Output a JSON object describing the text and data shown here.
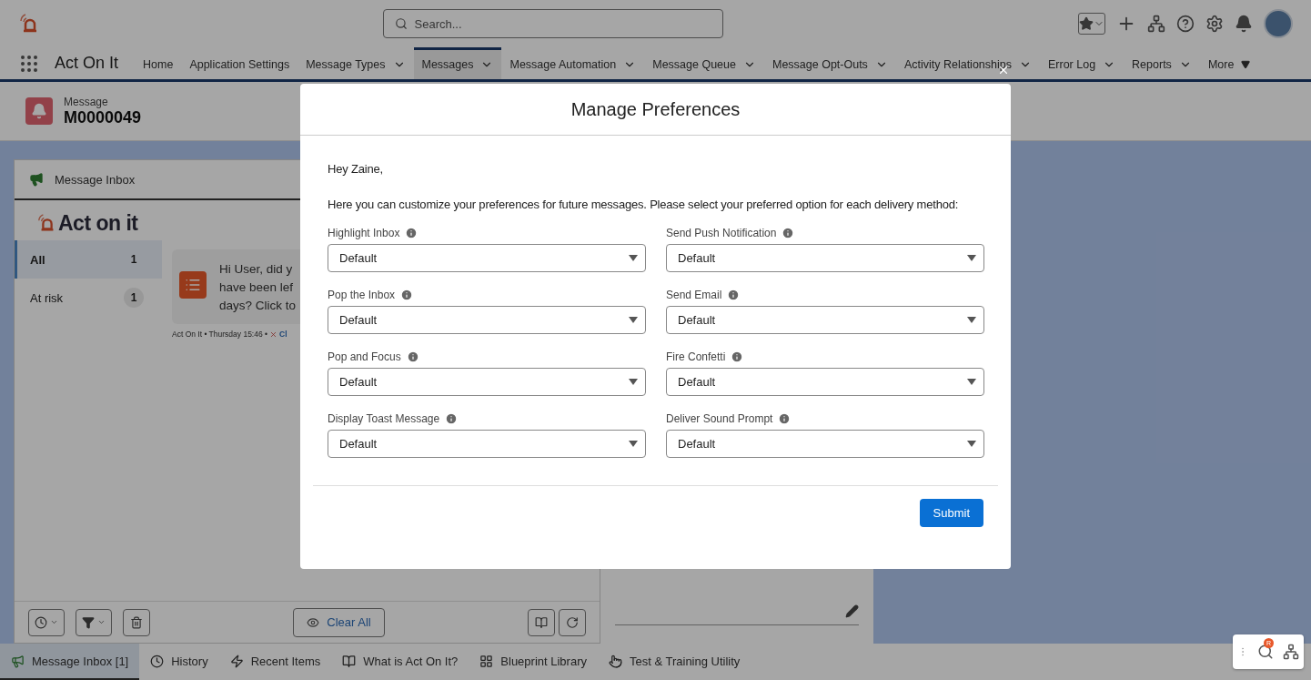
{
  "header": {
    "search_placeholder": "Search..."
  },
  "nav": {
    "app_name": "Act On It",
    "items": [
      {
        "label": "Home",
        "has_menu": false,
        "selected": false
      },
      {
        "label": "Application Settings",
        "has_menu": false,
        "selected": false
      },
      {
        "label": "Message Types",
        "has_menu": true,
        "selected": false
      },
      {
        "label": "Messages",
        "has_menu": true,
        "selected": true
      },
      {
        "label": "Message Automation",
        "has_menu": true,
        "selected": false
      },
      {
        "label": "Message Queue",
        "has_menu": true,
        "selected": false
      },
      {
        "label": "Message Opt-Outs",
        "has_menu": true,
        "selected": false
      },
      {
        "label": "Activity Relationships",
        "has_menu": true,
        "selected": false
      },
      {
        "label": "Error Log",
        "has_menu": true,
        "selected": false
      },
      {
        "label": "Reports",
        "has_menu": true,
        "selected": false
      }
    ],
    "more": "More"
  },
  "record": {
    "type": "Message",
    "name": "M0000049"
  },
  "inbox": {
    "title": "Message Inbox",
    "logo_text": "Act on it",
    "filters": [
      {
        "label": "All",
        "count": "1",
        "selected": true
      },
      {
        "label": "At risk",
        "count": "1",
        "selected": false
      }
    ],
    "message": {
      "lines": [
        "Hi User, did y",
        "have been lef",
        "days? Click to"
      ],
      "meta": "Act On It • Thursday 15:46 •",
      "action": "Cl"
    },
    "clear_all": "Clear All"
  },
  "utility_bar": [
    {
      "label": "Message Inbox [1]",
      "selected": true
    },
    {
      "label": "History",
      "selected": false
    },
    {
      "label": "Recent Items",
      "selected": false
    },
    {
      "label": "What is Act On It?",
      "selected": false
    },
    {
      "label": "Blueprint Library",
      "selected": false
    },
    {
      "label": "Test & Training Utility",
      "selected": false
    }
  ],
  "modal": {
    "title": "Manage Preferences",
    "greeting": "Hey Zaine,",
    "intro": "Here you can customize your preferences for future messages. Please select your preferred option for each delivery method:",
    "fields": [
      {
        "label": "Highlight Inbox",
        "value": "Default"
      },
      {
        "label": "Send Push Notification",
        "value": "Default"
      },
      {
        "label": "Pop the Inbox",
        "value": "Default"
      },
      {
        "label": "Send Email",
        "value": "Default"
      },
      {
        "label": "Pop and Focus",
        "value": "Default"
      },
      {
        "label": "Fire Confetti",
        "value": "Default"
      },
      {
        "label": "Display Toast Message",
        "value": "Default"
      },
      {
        "label": "Deliver Sound Prompt",
        "value": "Default"
      }
    ],
    "submit": "Submit"
  },
  "widget": {
    "badge": "R"
  }
}
